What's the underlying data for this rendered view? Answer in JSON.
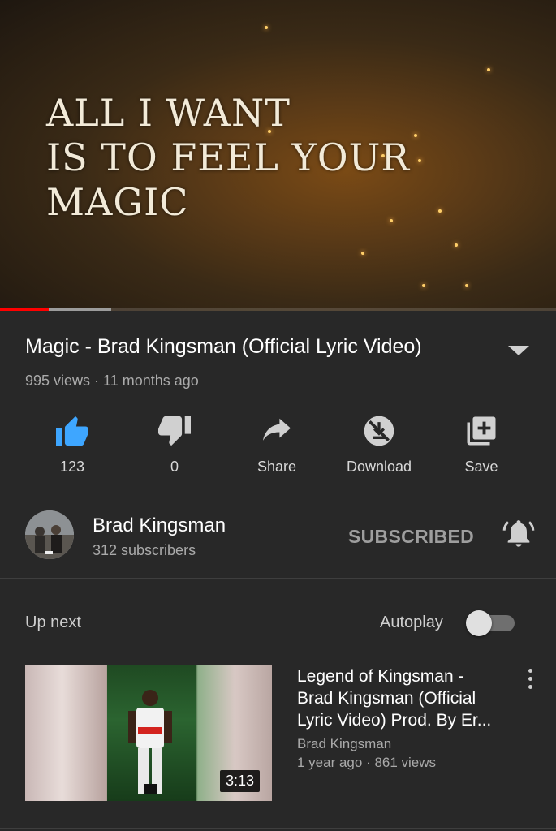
{
  "player": {
    "lyric_lines": [
      "ALL I WANT",
      "IS TO FEEL YOUR",
      "MAGIC"
    ],
    "progress_played": 0.087,
    "progress_buffered": 0.2
  },
  "video": {
    "title": "Magic - Brad Kingsman (Official Lyric Video)",
    "meta": "995 views · 11 months ago"
  },
  "actions": {
    "like": {
      "icon": "thumbs-up-icon",
      "label": "123",
      "color": "#3ea6ff"
    },
    "dislike": {
      "icon": "thumbs-down-icon",
      "label": "0"
    },
    "share": {
      "icon": "share-icon",
      "label": "Share"
    },
    "download": {
      "icon": "download-disabled-icon",
      "label": "Download"
    },
    "save": {
      "icon": "add-to-playlist-icon",
      "label": "Save"
    }
  },
  "channel": {
    "name": "Brad Kingsman",
    "subscribers": "312 subscribers",
    "subscribe_label": "SUBSCRIBED"
  },
  "upnext": {
    "heading": "Up next",
    "autoplay_label": "Autoplay",
    "autoplay_on": false,
    "items": [
      {
        "title_lines": [
          "Legend of Kingsman -",
          "Brad Kingsman (Official",
          "Lyric Video) Prod. By Er..."
        ],
        "channel": "Brad Kingsman",
        "meta": "1 year ago · 861 views",
        "duration": "3:13"
      }
    ]
  }
}
